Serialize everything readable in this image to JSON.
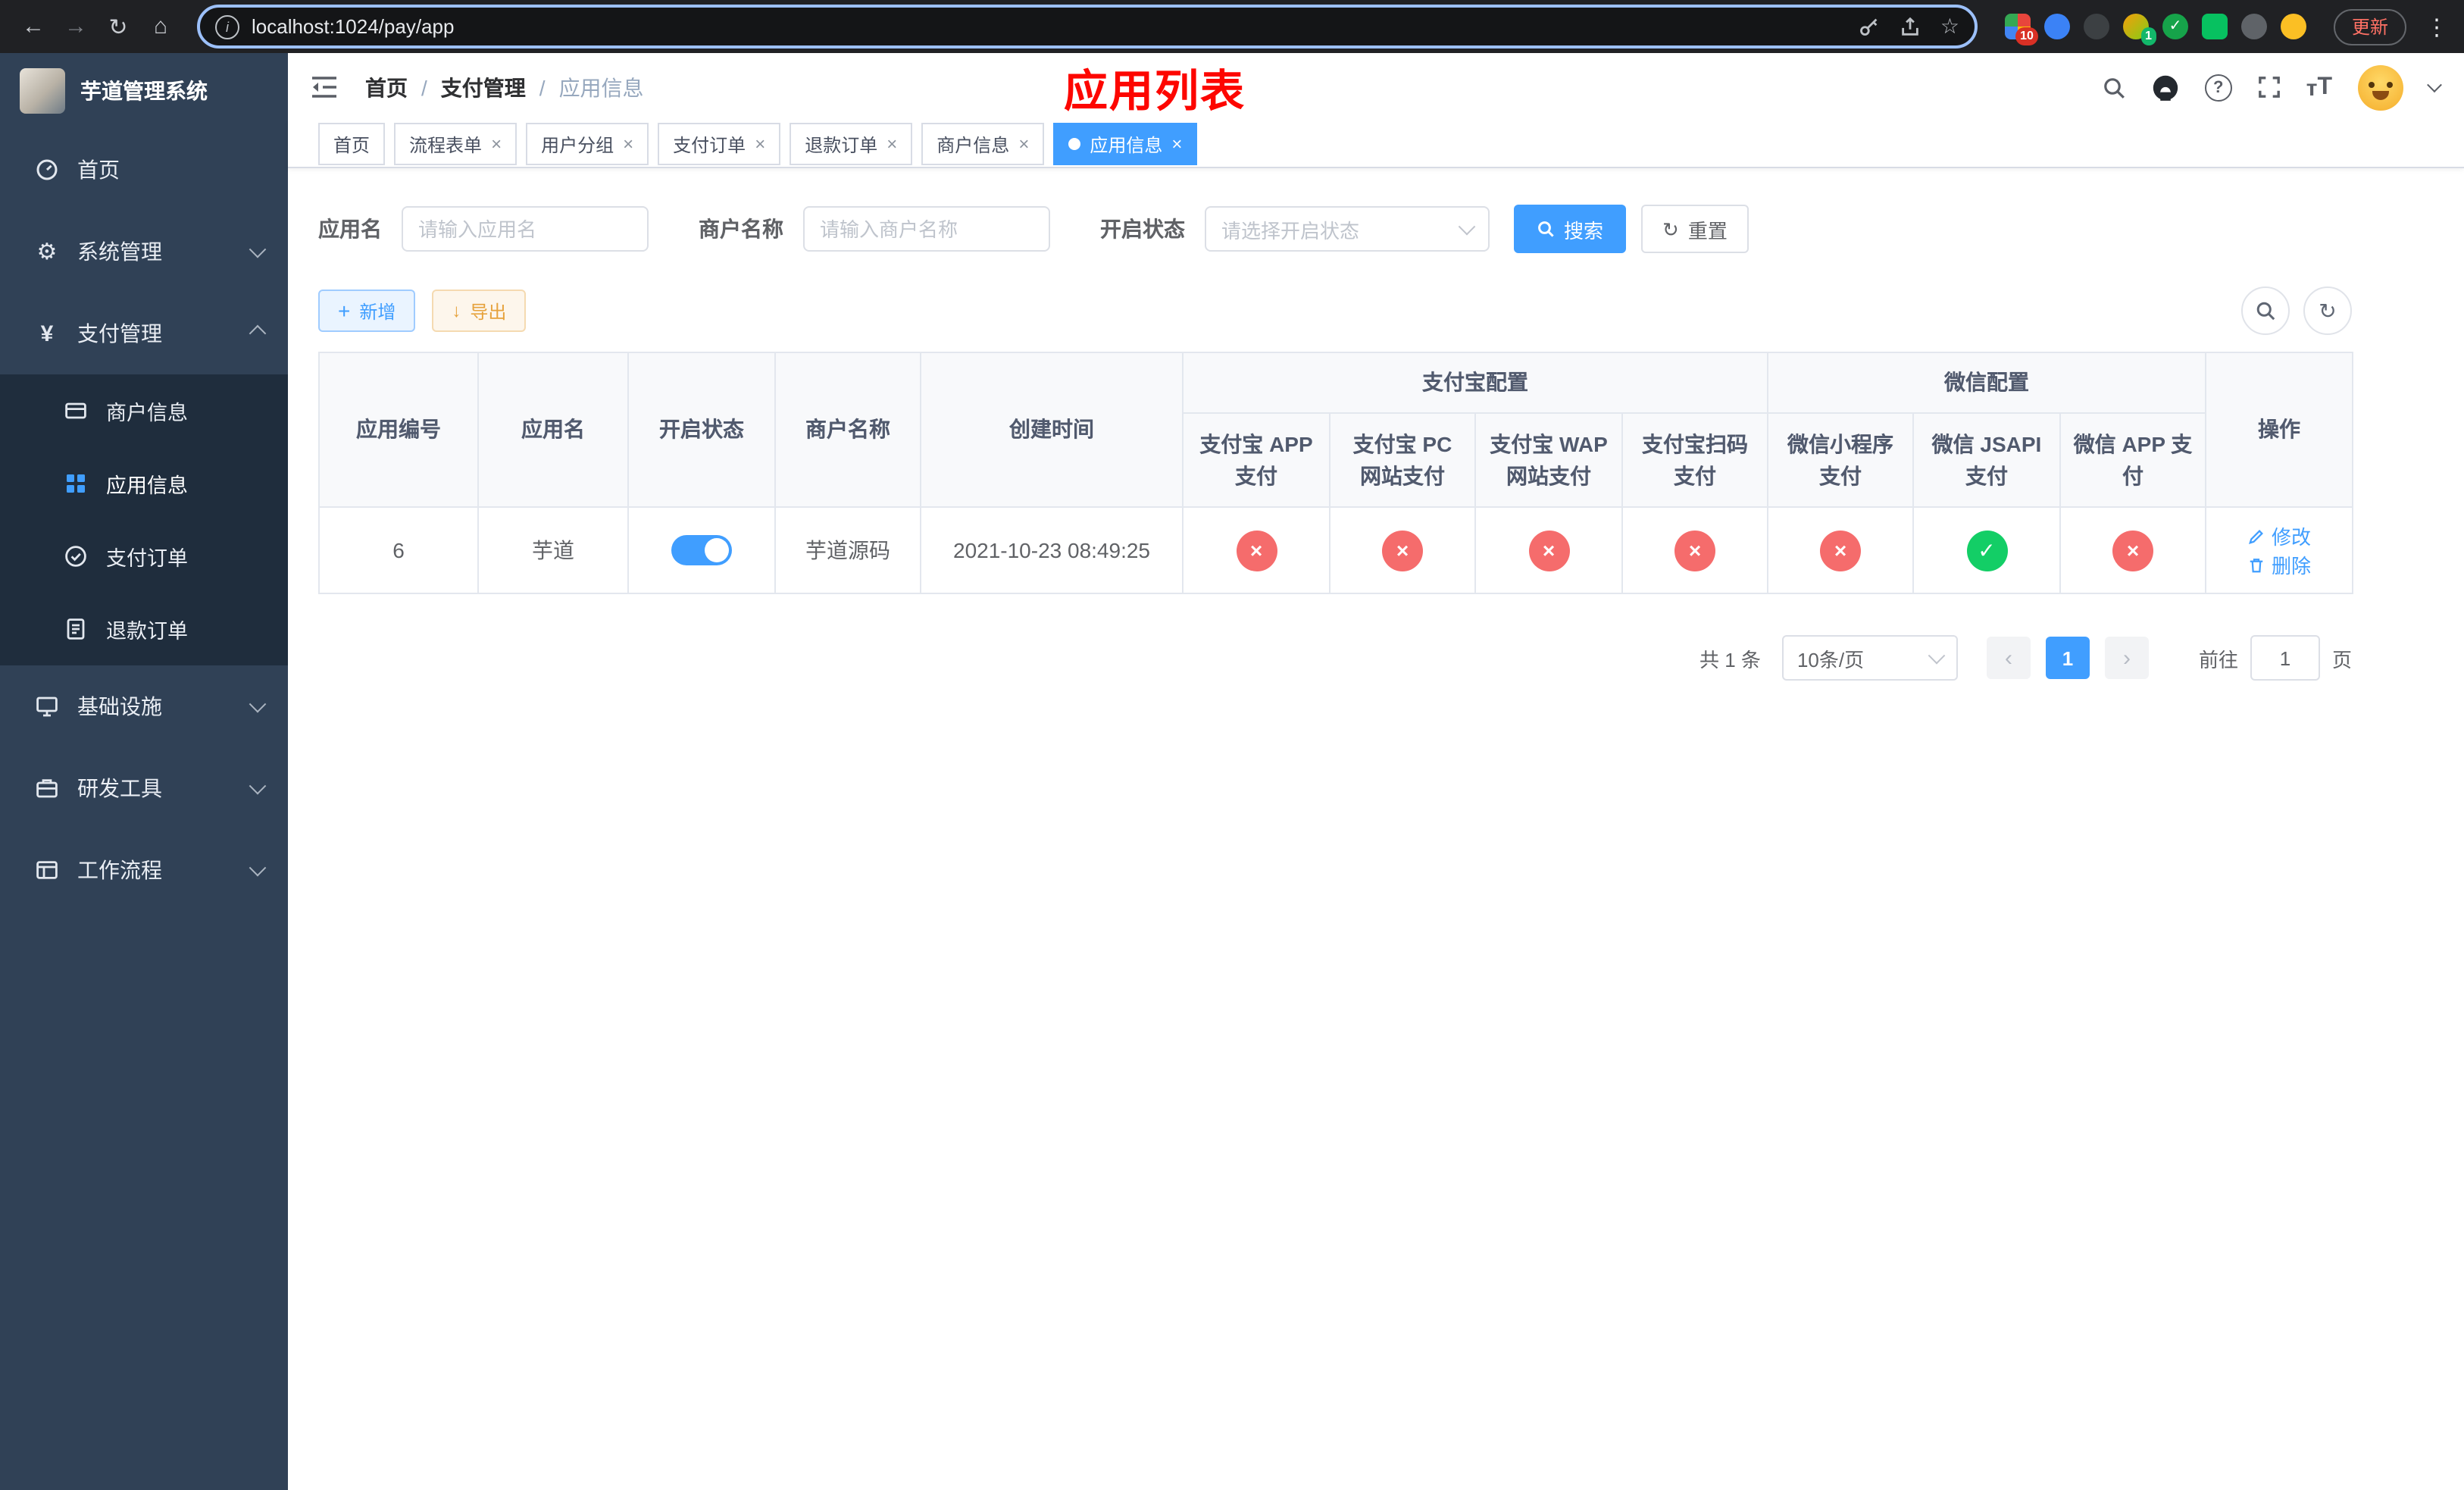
{
  "icons": {
    "back": "←",
    "forward": "→",
    "reload": "↻",
    "home": "⌂",
    "info": "i",
    "star": "☆",
    "gear": "⚙",
    "yen": "¥",
    "cross": "×",
    "check": "✓",
    "close": "×",
    "prev": "‹",
    "next": "›",
    "dots": "⋮",
    "plus": "+",
    "download": "↓",
    "question": "?",
    "refresh": "↻",
    "ext_check": "✓"
  },
  "colors": {
    "primary": "#409eff",
    "success": "#13ce66",
    "danger": "#f56c6c",
    "sidebar_bg": "#304156",
    "submenu_bg": "#1f2d3d",
    "annotation_red": "#fd0600"
  },
  "browser": {
    "url": "localhost:1024/pay/app",
    "update_button": "更新",
    "extension_badge_grid": "10",
    "extension_badge_avatar": "1"
  },
  "sidebar": {
    "logo_title": "芋道管理系统",
    "items": [
      {
        "label": "首页"
      },
      {
        "label": "系统管理"
      },
      {
        "label": "支付管理"
      },
      {
        "label": "商户信息"
      },
      {
        "label": "应用信息"
      },
      {
        "label": "支付订单"
      },
      {
        "label": "退款订单"
      },
      {
        "label": "基础设施"
      },
      {
        "label": "研发工具"
      },
      {
        "label": "工作流程"
      }
    ]
  },
  "header": {
    "breadcrumb": [
      "首页",
      "支付管理",
      "应用信息"
    ],
    "separator": "/",
    "page_title": "应用列表"
  },
  "tabs": [
    {
      "label": "首页"
    },
    {
      "label": "流程表单"
    },
    {
      "label": "用户分组"
    },
    {
      "label": "支付订单"
    },
    {
      "label": "退款订单"
    },
    {
      "label": "商户信息"
    },
    {
      "label": "应用信息"
    }
  ],
  "filters": {
    "app_name_label": "应用名",
    "app_name_placeholder": "请输入应用名",
    "merchant_name_label": "商户名称",
    "merchant_name_placeholder": "请输入商户名称",
    "status_label": "开启状态",
    "status_placeholder": "请选择开启状态",
    "search_button": "搜索",
    "reset_button": "重置"
  },
  "toolbar": {
    "add_button": "新增",
    "export_button": "导出"
  },
  "table": {
    "headers": {
      "app_id": "应用编号",
      "app_name": "应用名",
      "status": "开启状态",
      "merchant_name": "商户名称",
      "create_time": "创建时间",
      "alipay_group": "支付宝配置",
      "wechat_group": "微信配置",
      "alipay_app": "支付宝 APP 支付",
      "alipay_pc": "支付宝 PC 网站支付",
      "alipay_wap": "支付宝 WAP 网站支付",
      "alipay_qr": "支付宝扫码支付",
      "wechat_lite": "微信小程序支付",
      "wechat_jsapi": "微信 JSAPI 支付",
      "wechat_app": "微信 APP 支付",
      "actions": "操作"
    },
    "rows": [
      {
        "app_id": "6",
        "app_name": "芋道",
        "status_enabled": true,
        "merchant_name": "芋道源码",
        "create_time": "2021-10-23 08:49:25",
        "alipay_app": false,
        "alipay_pc": false,
        "alipay_wap": false,
        "alipay_qr": false,
        "wechat_lite": false,
        "wechat_jsapi": true,
        "wechat_app": false,
        "edit_label": "修改",
        "delete_label": "删除"
      }
    ]
  },
  "pagination": {
    "total_text": "共 1 条",
    "page_size_text": "10条/页",
    "current_page": "1",
    "goto_label": "前往",
    "goto_value": "1",
    "page_unit_label": "页"
  }
}
